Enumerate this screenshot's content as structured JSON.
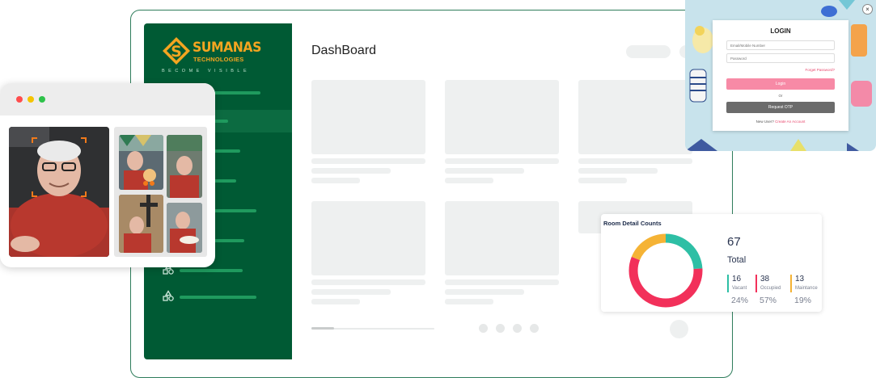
{
  "dashboard": {
    "title": "DashBoard",
    "brand": {
      "name": "SUMANAS",
      "subtitle": "TECHNOLOGIES",
      "tagline": "BECOME VISIBLE",
      "logo_color": "#f4a520",
      "sidebar_color": "#005a34"
    }
  },
  "login": {
    "title": "LOGIN",
    "email_placeholder": "Email/Mobile Number",
    "password_placeholder": "Password",
    "forgot": "Forget Password?",
    "login_button": "Login",
    "or": "Or",
    "otp_button": "Request OTP",
    "new_user": "New User?",
    "create_account": "Create An Account",
    "close_icon": "×"
  },
  "room": {
    "title": "Room Detail Counts",
    "total": "67",
    "total_label": "Total",
    "stats": [
      {
        "count": "16",
        "label": "Vacant",
        "percent": "24%",
        "color": "#2ebfa5",
        "fraction": 0.24
      },
      {
        "count": "38",
        "label": "Occupied",
        "percent": "57%",
        "color": "#f2305a",
        "fraction": 0.57
      },
      {
        "count": "13",
        "label": "Maintance",
        "percent": "19%",
        "color": "#f5b335",
        "fraction": 0.19
      }
    ]
  }
}
